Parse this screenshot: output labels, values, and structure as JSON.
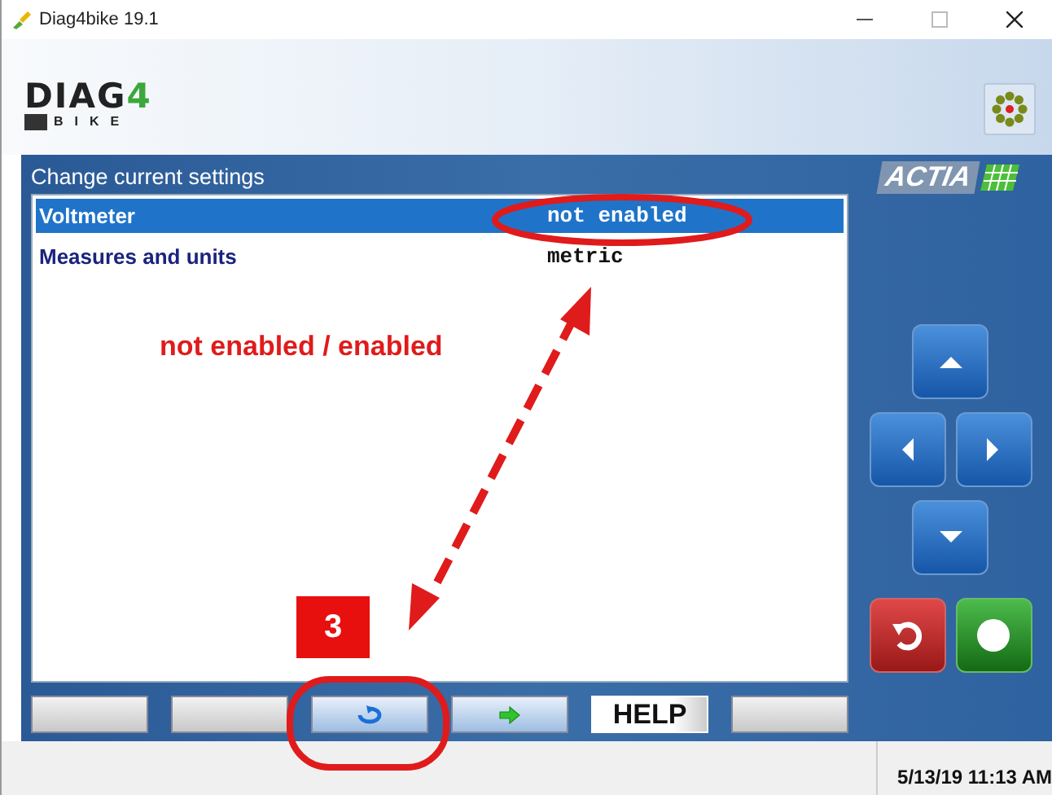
{
  "window": {
    "title": "Diag4bike 19.1"
  },
  "logo": {
    "name": "DIAG",
    "accent": "4",
    "tagline": "BIKE"
  },
  "panel": {
    "title": "Change current settings"
  },
  "settings": [
    {
      "label": "Voltmeter",
      "value": "not enabled",
      "selected": true
    },
    {
      "label": "Measures and units",
      "value": "metric",
      "selected": false
    }
  ],
  "vendor_logo": "ACTIA",
  "nav_buttons": [
    {
      "kind": "up"
    },
    {
      "kind": "left"
    },
    {
      "kind": "right"
    },
    {
      "kind": "down"
    },
    {
      "kind": "cancel"
    },
    {
      "kind": "ok"
    }
  ],
  "function_keys": [
    {
      "kind": "blank"
    },
    {
      "kind": "blank"
    },
    {
      "kind": "refresh"
    },
    {
      "kind": "next"
    },
    {
      "kind": "text",
      "label": "HELP"
    },
    {
      "kind": "blank"
    }
  ],
  "status_bar": {
    "datetime": "5/13/19 11:13 AM"
  },
  "annotations": {
    "caption": "not enabled / enabled",
    "step": "3"
  }
}
